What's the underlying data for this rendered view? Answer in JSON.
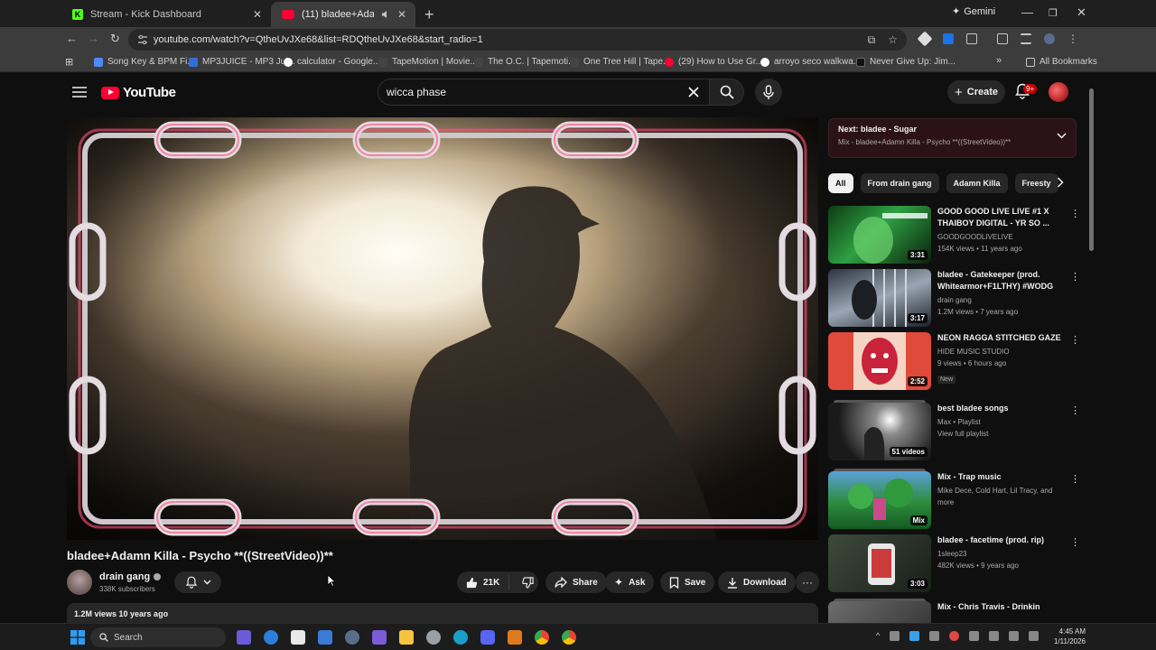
{
  "browser": {
    "tabs": [
      {
        "label": "Stream - Kick Dashboard",
        "close": "✕"
      },
      {
        "label": "(11) bladee+Adamn Killa - ",
        "close": "✕"
      }
    ],
    "new_tab": "+",
    "gemini_label": "Gemini",
    "url": "youtube.com/watch?v=QtheUvJXe68&list=RDQtheUvJXe68&start_radio=1",
    "bookmarks": [
      {
        "label": "Song Key & BPM Fi...",
        "color": "#4c8bf5"
      },
      {
        "label": "MP3JUICE - MP3 Jui...",
        "color": "#2f6fd6"
      },
      {
        "label": "calculator - Google...",
        "color": "#ffffff"
      },
      {
        "label": "TapeMotion | Movie...",
        "color": "#333333"
      },
      {
        "label": "The O.C. | Tapemoti...",
        "color": "#333333"
      },
      {
        "label": "One Tree Hill | Tape...",
        "color": "#333333"
      },
      {
        "label": "(29) How to Use Gr...",
        "color": "#ff0033"
      },
      {
        "label": "arroyo seco walkwa...",
        "color": "#ffffff"
      },
      {
        "label": "Never Give Up: Jim...",
        "color": "#111111"
      }
    ],
    "all_bookmarks": "All Bookmarks",
    "more_bookmarks": "»"
  },
  "youtube": {
    "logo_text": "YouTube",
    "search_value": "wicca phase",
    "create_label": "Create",
    "notifications": "9+",
    "video": {
      "title": "bladee+Adamn Killa - Psycho **((StreetVideo))**",
      "channel": "drain gang",
      "subscribers": "338K subscribers",
      "likes": "21K",
      "share": "Share",
      "ask": "Ask",
      "save": "Save",
      "download": "Download",
      "more": "···",
      "description": "1.2M views  10 years ago"
    },
    "next_up": {
      "title": "Next: bladee - Sugar",
      "subtitle": "Mix - bladee+Adamn Killa - Psycho **((StreetVideo))**"
    },
    "chips": [
      "All",
      "From drain gang",
      "Adamn Killa",
      "Freesty"
    ],
    "recommendations": [
      {
        "title": "GOOD GOOD LIVE LIVE #1 X THAIBOY DIGITAL - YR SO ...",
        "channel": "GOODGOODLIVELIVE",
        "meta": "154K views • 11 years ago",
        "duration": "3:31"
      },
      {
        "title": "bladee - Gatekeeper (prod. Whitearmor+F1LTHY) #WODG",
        "channel": "drain gang",
        "meta": "1.2M views • 7 years ago",
        "duration": "3:17"
      },
      {
        "title": "NEON RAGGA STITCHED GAZE",
        "channel": "HIDE MUSIC STUDIO",
        "meta": "9 views • 6 hours ago",
        "badge": "New",
        "duration": "2:52"
      },
      {
        "title": "best bladee songs",
        "channel": "Max • Playlist",
        "meta": "View full playlist",
        "duration": "51 videos"
      },
      {
        "title": "Mix - Trap music",
        "channel": "Mike Dece, Cold Hart, Lil Tracy, and more",
        "meta": "",
        "duration": "Mix"
      },
      {
        "title": "bladee - facetime (prod. rip)",
        "channel": "1sleep23",
        "meta": "482K views • 9 years ago",
        "duration": "3:03"
      },
      {
        "title": "Mix - Chris Travis - Drinkin",
        "channel": "",
        "meta": "",
        "duration": ""
      }
    ]
  },
  "taskbar": {
    "search_placeholder": "Search",
    "time": "4:45 AM",
    "date": "1/11/2026"
  },
  "colors": {
    "background": "#0f0f0f",
    "accent_red": "#ff0033",
    "kick_green": "#53fc18"
  }
}
